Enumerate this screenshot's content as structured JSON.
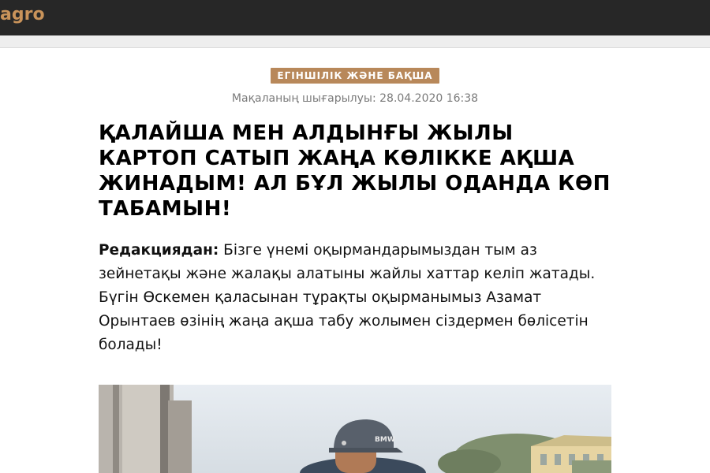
{
  "header": {
    "logo_text": "agro",
    "logo_color": "#c9935a",
    "bar_color": "#272727"
  },
  "article": {
    "category": "ЕГІНШІЛІК ЖӘНЕ БАҚША",
    "published": "Мақаланың шығарылуы: 28.04.2020 16:38",
    "title": "ҚАЛАЙША МЕН АЛДЫНҒЫ ЖЫЛЫ КАРТОП САТЫП ЖАҢА КӨЛІККЕ АҚША ЖИНАДЫМ! АЛ БҰЛ ЖЫЛЫ ОДАНДА КӨП ТАБАМЫН!",
    "lead_label": "Редакциядан:",
    "lead_text": "Бізге үнемі оқырмандарымыздан тым аз зейнетақы және жалақы алатыны жайлы хаттар келіп жатады. Бүгін Өскемен қаласынан тұрақты оқырманымыз Азамат Орынтаев өзінің жаңа ақша табу жолымен сіздермен бөлісетін болады!",
    "category_color": "#b8885a"
  },
  "photo": {
    "cap_text": "BMW"
  }
}
